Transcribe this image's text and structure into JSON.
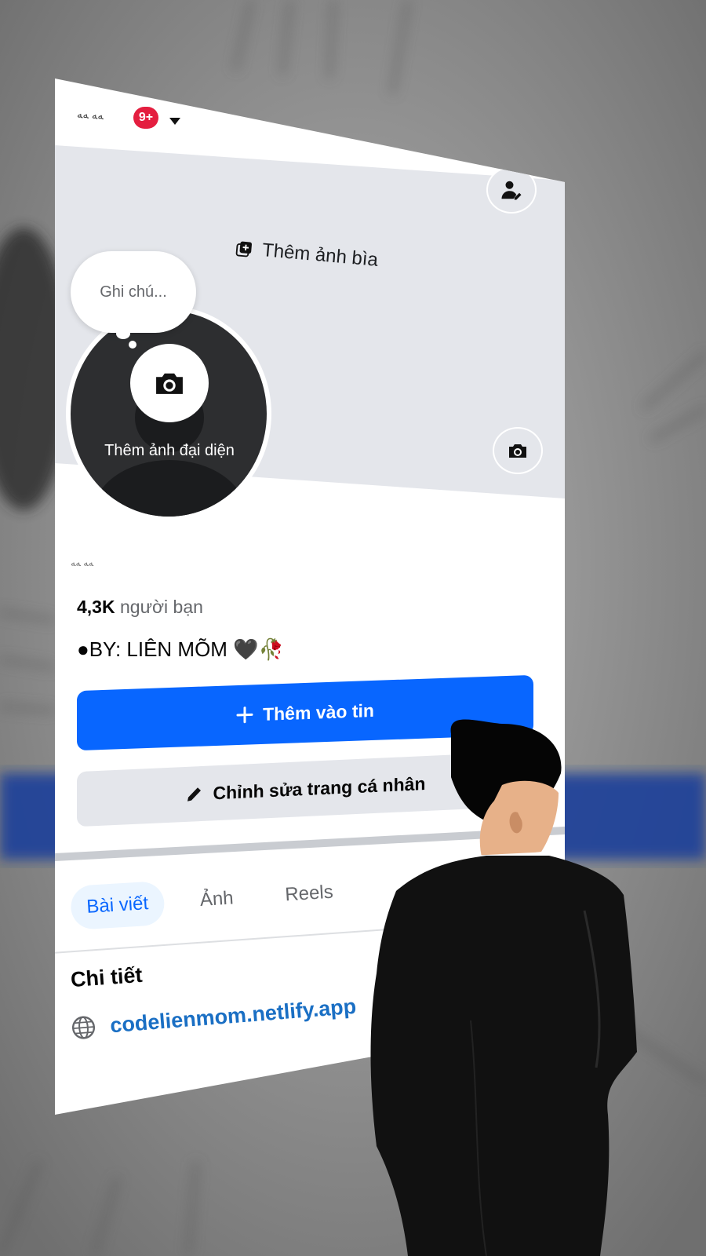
{
  "topbar": {
    "name": "ﻪﻪ ﻪﻪ",
    "notification_count": "9+"
  },
  "cover": {
    "add_cover_label": "Thêm ảnh bìa"
  },
  "profile_note": {
    "placeholder": "Ghi chú..."
  },
  "avatar": {
    "add_label": "Thêm ảnh đại diện"
  },
  "profile": {
    "username": "ﻪﻪ ﻪﻪ",
    "friends_count": "4,3K",
    "friends_label": "người bạn",
    "bio": "●BY: LIÊN MÕM 🖤🥀"
  },
  "actions": {
    "add_to_story": "Thêm vào tin",
    "edit_profile": "Chỉnh sửa trang cá nhân"
  },
  "tabs": [
    {
      "label": "Bài viết",
      "active": true
    },
    {
      "label": "Ảnh",
      "active": false
    },
    {
      "label": "Reels",
      "active": false
    }
  ],
  "details": {
    "title": "Chi tiết",
    "website": "codelienmom.netlify.app"
  },
  "icons": {
    "camera": "camera-icon",
    "user_edit": "user-edit-icon",
    "cover_photo": "photo-stack-icon",
    "plus": "plus-icon",
    "pencil": "pencil-icon",
    "globe": "globe-icon",
    "caret": "caret-down-icon"
  },
  "colors": {
    "primary": "#0866ff",
    "badge": "#e41e3f",
    "secondary_bg": "#e4e6eb",
    "link": "#1a6fc4"
  }
}
